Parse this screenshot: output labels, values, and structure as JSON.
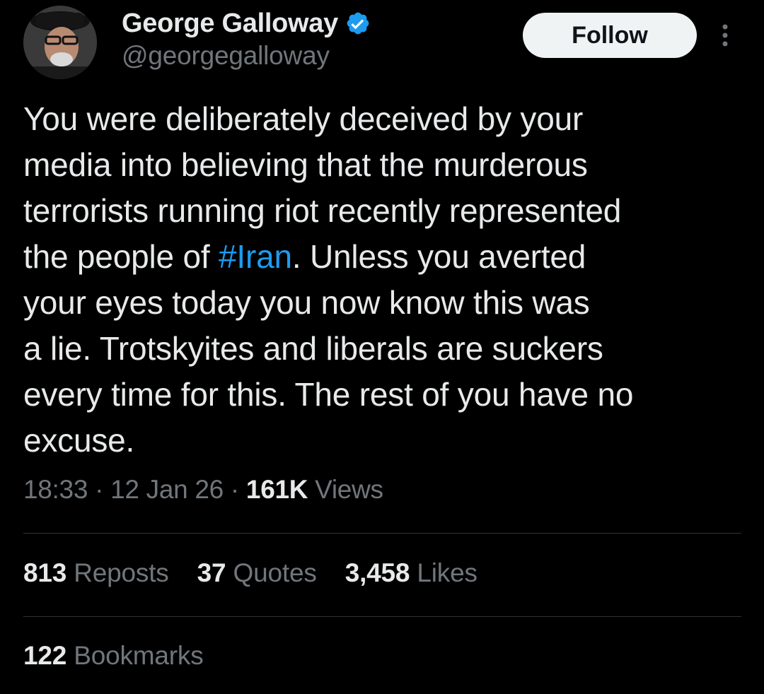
{
  "author": {
    "display_name": "George Galloway",
    "handle": "@georgegalloway",
    "verified": true,
    "avatar_icon": "profile-photo"
  },
  "follow_label": "Follow",
  "more_icon": "more-options-icon",
  "tweet": {
    "lines": [
      {
        "before": "You were deliberately deceived by your",
        "hashtag": "",
        "after": ""
      },
      {
        "before": "media into believing that the murderous",
        "hashtag": "",
        "after": ""
      },
      {
        "before": "terrorists running riot recently represented",
        "hashtag": "",
        "after": ""
      },
      {
        "before": "the people of ",
        "hashtag": "#Iran",
        "after": ". Unless you averted"
      },
      {
        "before": "your eyes today you now know this was",
        "hashtag": "",
        "after": ""
      },
      {
        "before": "a lie. Trotskyites and liberals are suckers",
        "hashtag": "",
        "after": ""
      },
      {
        "before": "every time for this. The rest of you have no",
        "hashtag": "",
        "after": ""
      },
      {
        "before": "excuse.",
        "hashtag": "",
        "after": ""
      }
    ]
  },
  "meta": {
    "time": "18:33",
    "separator": "·",
    "date": "12 Jan 26",
    "views_count": "161K",
    "views_label": "Views"
  },
  "stats": {
    "reposts_count": "813",
    "reposts_label": "Reposts",
    "quotes_count": "37",
    "quotes_label": "Quotes",
    "likes_count": "3,458",
    "likes_label": "Likes",
    "bookmarks_count": "122",
    "bookmarks_label": "Bookmarks"
  },
  "colors": {
    "background": "#000000",
    "text_primary": "#e7e9ea",
    "text_secondary": "#71767b",
    "link": "#1d9bf0",
    "divider": "#2f3336",
    "follow_bg": "#eff3f4"
  }
}
